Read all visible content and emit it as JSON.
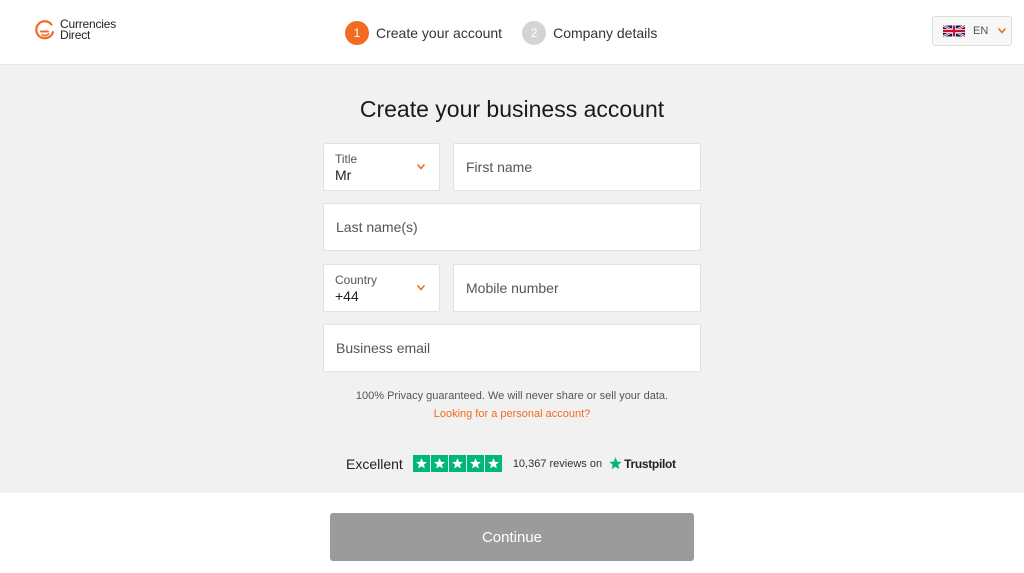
{
  "brand": {
    "name_line1": "Currencies",
    "name_line2": "Direct",
    "color": "#f26b21"
  },
  "steps": [
    {
      "number": "1",
      "label": "Create your account",
      "state": "active"
    },
    {
      "number": "2",
      "label": "Company details",
      "state": "inactive"
    }
  ],
  "language": {
    "code": "EN",
    "flag_icon": "uk-flag-icon"
  },
  "page_title": "Create your business account",
  "form": {
    "title": {
      "label": "Title",
      "value": "Mr"
    },
    "first_name": {
      "placeholder": "First name"
    },
    "last_name": {
      "placeholder": "Last name(s)"
    },
    "country": {
      "label": "Country",
      "value": "+44"
    },
    "mobile": {
      "placeholder": "Mobile number"
    },
    "email": {
      "placeholder": "Business email"
    }
  },
  "privacy_text": "100% Privacy guaranteed. We will never share or sell your data.",
  "personal_link": "Looking for a personal account?",
  "trustpilot": {
    "rating_text": "Excellent",
    "stars": 5,
    "reviews_text": "10,367 reviews on",
    "brand": "Trustpilot",
    "star_color": "#00b67a"
  },
  "continue_label": "Continue"
}
